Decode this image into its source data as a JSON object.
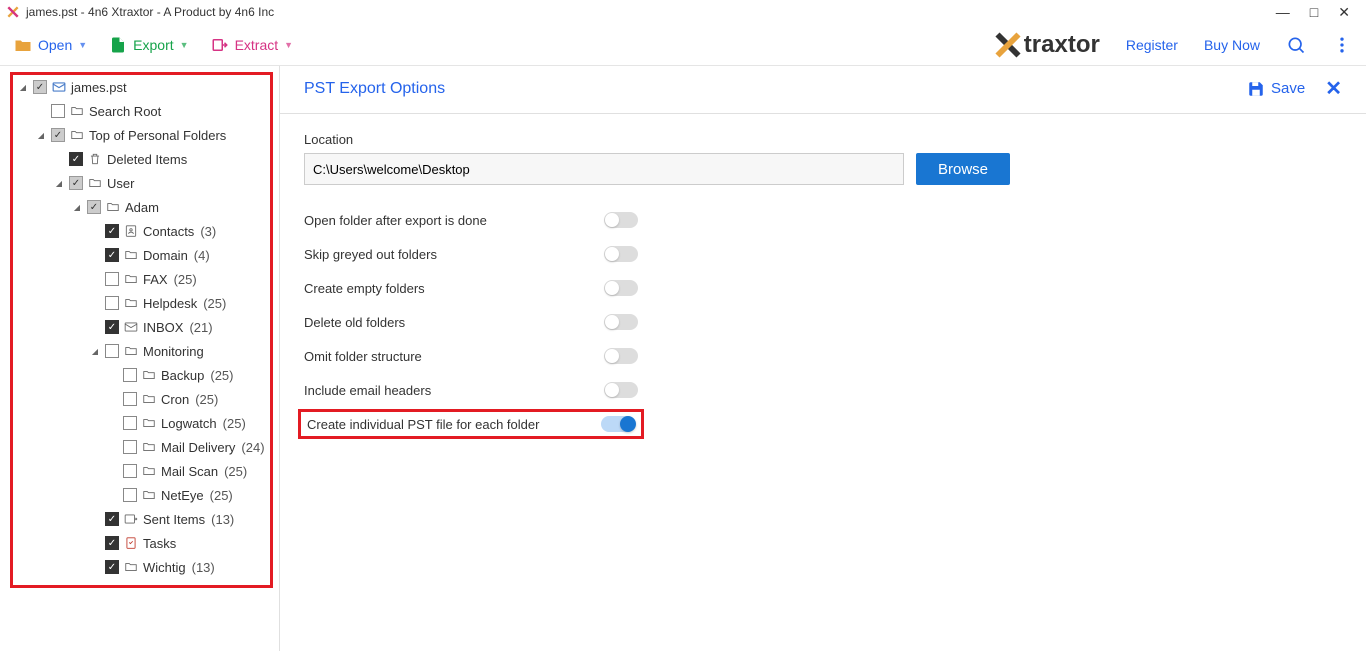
{
  "window": {
    "title": "james.pst - 4n6 Xtraxtor - A Product by 4n6 Inc"
  },
  "toolbar": {
    "open": "Open",
    "export": "Export",
    "extract": "Extract",
    "brand": "traxtor",
    "register": "Register",
    "buy": "Buy Now"
  },
  "tree": [
    {
      "indent": 0,
      "exp": "▾",
      "check": "grey",
      "icon": "mail",
      "label": "james.pst",
      "count": ""
    },
    {
      "indent": 1,
      "exp": "",
      "check": "",
      "icon": "folder",
      "label": "Search Root",
      "count": ""
    },
    {
      "indent": 1,
      "exp": "▾",
      "check": "grey",
      "icon": "folder",
      "label": "Top of Personal Folders",
      "count": ""
    },
    {
      "indent": 2,
      "exp": "",
      "check": "checked",
      "icon": "trash",
      "label": "Deleted Items",
      "count": ""
    },
    {
      "indent": 2,
      "exp": "▾",
      "check": "grey",
      "icon": "folder",
      "label": "User",
      "count": ""
    },
    {
      "indent": 3,
      "exp": "▾",
      "check": "grey",
      "icon": "folder",
      "label": "Adam",
      "count": ""
    },
    {
      "indent": 4,
      "exp": "",
      "check": "checked",
      "icon": "contacts",
      "label": "Contacts",
      "count": "(3)"
    },
    {
      "indent": 4,
      "exp": "",
      "check": "checked",
      "icon": "folder",
      "label": "Domain",
      "count": "(4)"
    },
    {
      "indent": 4,
      "exp": "",
      "check": "",
      "icon": "folder",
      "label": "FAX",
      "count": "(25)"
    },
    {
      "indent": 4,
      "exp": "",
      "check": "",
      "icon": "folder",
      "label": "Helpdesk",
      "count": "(25)"
    },
    {
      "indent": 4,
      "exp": "",
      "check": "checked",
      "icon": "inbox",
      "label": "INBOX",
      "count": "(21)"
    },
    {
      "indent": 4,
      "exp": "▾",
      "check": "",
      "icon": "folder",
      "label": "Monitoring",
      "count": ""
    },
    {
      "indent": 5,
      "exp": "",
      "check": "",
      "icon": "folder",
      "label": "Backup",
      "count": "(25)"
    },
    {
      "indent": 5,
      "exp": "",
      "check": "",
      "icon": "folder",
      "label": "Cron",
      "count": "(25)"
    },
    {
      "indent": 5,
      "exp": "",
      "check": "",
      "icon": "folder",
      "label": "Logwatch",
      "count": "(25)"
    },
    {
      "indent": 5,
      "exp": "",
      "check": "",
      "icon": "folder",
      "label": "Mail Delivery",
      "count": "(24)"
    },
    {
      "indent": 5,
      "exp": "",
      "check": "",
      "icon": "folder",
      "label": "Mail Scan",
      "count": "(25)"
    },
    {
      "indent": 5,
      "exp": "",
      "check": "",
      "icon": "folder",
      "label": "NetEye",
      "count": "(25)"
    },
    {
      "indent": 4,
      "exp": "",
      "check": "checked",
      "icon": "sent",
      "label": "Sent Items",
      "count": "(13)"
    },
    {
      "indent": 4,
      "exp": "",
      "check": "checked",
      "icon": "tasks",
      "label": "Tasks",
      "count": ""
    },
    {
      "indent": 4,
      "exp": "",
      "check": "checked",
      "icon": "folder",
      "label": "Wichtig",
      "count": "(13)"
    }
  ],
  "panel": {
    "title": "PST Export Options",
    "save": "Save",
    "location_label": "Location",
    "location_value": "C:\\Users\\welcome\\Desktop",
    "browse": "Browse",
    "options": [
      {
        "label": "Open folder after export is done",
        "on": false
      },
      {
        "label": "Skip greyed out folders",
        "on": false
      },
      {
        "label": "Create empty folders",
        "on": false
      },
      {
        "label": "Delete old folders",
        "on": false
      },
      {
        "label": "Omit folder structure",
        "on": false
      },
      {
        "label": "Include email headers",
        "on": false
      }
    ],
    "highlighted_option": {
      "label": "Create individual PST file for each folder",
      "on": true
    }
  }
}
